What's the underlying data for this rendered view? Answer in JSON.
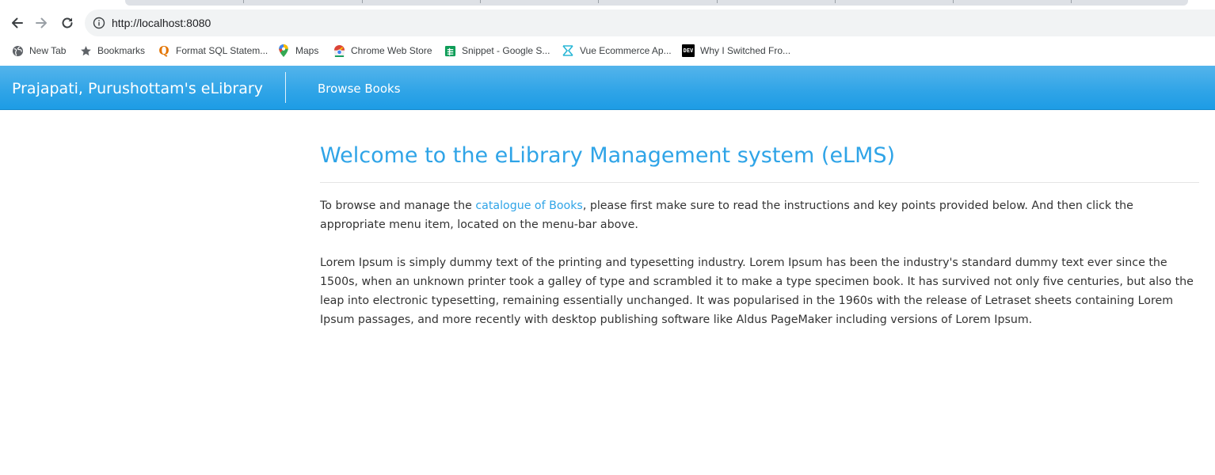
{
  "browser": {
    "url": "http://localhost:8080",
    "bookmarks": [
      {
        "label": "New Tab",
        "icon": "globe-icon"
      },
      {
        "label": "Bookmarks",
        "icon": "star-icon"
      },
      {
        "label": "Format SQL Statem...",
        "icon": "format-sql-icon"
      },
      {
        "label": "Maps",
        "icon": "maps-pin-icon"
      },
      {
        "label": "Chrome Web Store",
        "icon": "chrome-web-store-icon"
      },
      {
        "label": "Snippet - Google S...",
        "icon": "google-sheets-icon"
      },
      {
        "label": "Vue Ecommerce Ap...",
        "icon": "vue-ecommerce-icon"
      },
      {
        "label": "Why I Switched Fro...",
        "icon": "dev-icon"
      }
    ],
    "dev_icon_text": "DEV",
    "sql_icon_text": "Q"
  },
  "navbar": {
    "brand": "Prajapati, Purushottam's eLibrary",
    "link": "Browse Books",
    "colors": {
      "background": "#2fa4e7",
      "text": "#ffffff"
    }
  },
  "main": {
    "title": "Welcome to the eLibrary Management system (eLMS)",
    "intro_before": "To browse and manage the ",
    "intro_link": "catalogue of Books",
    "intro_after": ", please first make sure to read the instructions and key points provided below. And then click the appropriate menu item, located on the menu-bar above.",
    "lorem": "Lorem Ipsum is simply dummy text of the printing and typesetting industry. Lorem Ipsum has been the industry's standard dummy text ever since the 1500s, when an unknown printer took a galley of type and scrambled it to make a type specimen book. It has survived not only five centuries, but also the leap into electronic typesetting, remaining essentially unchanged. It was popularised in the 1960s with the release of Letraset sheets containing Lorem Ipsum passages, and more recently with desktop publishing software like Aldus PageMaker including versions of Lorem Ipsum.",
    "colors": {
      "accent": "#2fa4e7",
      "text": "#333333"
    }
  }
}
